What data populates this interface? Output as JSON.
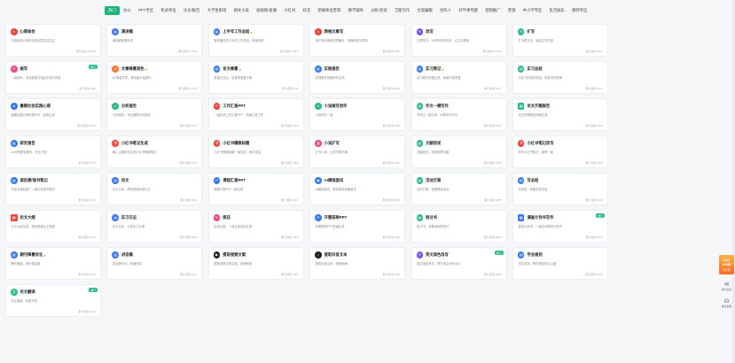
{
  "tabs": [
    {
      "label": "热门",
      "active": true
    },
    {
      "label": "办公"
    },
    {
      "label": "PPT专区"
    },
    {
      "label": "机关单位"
    },
    {
      "label": "论文/报告"
    },
    {
      "label": "大学生职场"
    },
    {
      "label": "网文小说"
    },
    {
      "label": "短视频/直播"
    },
    {
      "label": "小红书"
    },
    {
      "label": "抖音"
    },
    {
      "label": "新媒体运营等"
    },
    {
      "label": "教学辅导"
    },
    {
      "label": "分析/咨询"
    },
    {
      "label": "万能写作"
    },
    {
      "label": "文案编辑"
    },
    {
      "label": "创作人"
    },
    {
      "label": "开学季专题"
    },
    {
      "label": "营销推广"
    },
    {
      "label": "营销"
    },
    {
      "label": "中小学专区"
    },
    {
      "label": "生活娱乐"
    },
    {
      "label": "教师专区"
    }
  ],
  "colors": {
    "accent": "#1fb37a",
    "blue": "#3a7bf4",
    "red": "#f0453c",
    "orange": "#ff7a2a",
    "green": "#2ebc83",
    "purple": "#6a5cf6",
    "pink": "#f04a7e",
    "dark": "#222222"
  },
  "cards": [
    {
      "title": "心得体会",
      "desc": "文档精准心得体会的创意生成文文",
      "meta": "累计使用 257/23",
      "icon": "flame-icon",
      "color": "#f0453c",
      "sym": "♦"
    },
    {
      "title": "演讲稿",
      "desc": "演讲稿快速写作",
      "meta": "累计使用 7/51/5",
      "icon": "document-icon",
      "color": "#3a7bf4",
      "sym": "▤"
    },
    {
      "title": "上半年工作总结",
      "flame": true,
      "desc": "做到通过的个月的工作总结，快速完成",
      "meta": "累计使用 7/58/7",
      "icon": "document-icon",
      "color": "#3a7bf4",
      "sym": "▤"
    },
    {
      "title": "网络文章写",
      "desc": "用于现代网络文章编写，快速完成文章标",
      "meta": "累计使用 4/6/1",
      "icon": "flame-icon",
      "color": "#f0453c",
      "sym": "♦"
    },
    {
      "title": "改写",
      "desc": "文章改写，AI写作改写优化，让文字更美",
      "meta": "累计使用 4/7/48",
      "icon": "pen-icon",
      "color": "#6a5cf6",
      "sym": "✎"
    },
    {
      "title": "扩写",
      "desc": "扩写短文本，增加文字内容",
      "meta": "累计使用 4/1/2",
      "icon": "pen-icon",
      "color": "#2ebc83",
      "sym": "✎"
    },
    {
      "title": "",
      "desc": "",
      "meta": "",
      "icon": "",
      "color": "",
      "sym": "",
      "empty": true
    },
    {
      "title": "续写",
      "badge": "热门",
      "desc": "一键续写，完成各类文档后半部分内容",
      "meta": "累计使用 5/63",
      "icon": "pen-icon",
      "color": "#f04a7e",
      "sym": "✎"
    },
    {
      "title": "文章降重润色",
      "flame": true,
      "desc": "AI 降重文章，原创度大幅提升",
      "meta": "累计使用 7/47/6",
      "icon": "flame-icon",
      "color": "#ff7a2a",
      "sym": "♦"
    },
    {
      "title": "论文降重",
      "flame": true,
      "desc": "降重论文后，查重率显著下降",
      "meta": "累计使用 4/59",
      "icon": "document-icon",
      "color": "#3a7bf4",
      "sym": "▤"
    },
    {
      "title": "实践报告",
      "desc": "实践报告快速写作生成",
      "meta": "累计使用 4/6/1",
      "icon": "document-icon",
      "color": "#3a7bf4",
      "sym": "▤"
    },
    {
      "title": "实习周记",
      "flame": true,
      "desc": "实习周记快速生成，每周内容完整",
      "meta": "累计使用 4/6/1",
      "icon": "document-icon",
      "color": "#3a7bf4",
      "sym": "▤"
    },
    {
      "title": "实习总结",
      "desc": "为实习阶段写总结，提高写作效率",
      "meta": "累计使用 4/6/1",
      "icon": "document-icon",
      "color": "#2ebc83",
      "sym": "▤"
    },
    {
      "title": "",
      "desc": "",
      "meta": "",
      "icon": "",
      "color": "",
      "sym": "",
      "empty": true
    },
    {
      "title": "暑期社会实践心得",
      "desc": "暑期实践心得快速写作，精炼生成",
      "meta": "累计使用 4/6/61",
      "icon": "user-icon",
      "color": "#3a7bf4",
      "sym": "●"
    },
    {
      "title": "分析报告",
      "desc": "分析报告，专业数据分析报告",
      "meta": "累计使用 4/7/6",
      "icon": "chart-icon",
      "color": "#2ebc83",
      "sym": "◐"
    },
    {
      "title": "工作汇报PPT",
      "desc": "一键生成工作汇报PPT，快速汇报工作",
      "meta": "累计使用 4/8/1",
      "icon": "ppt-icon",
      "color": "#f0453c",
      "sym": "P"
    },
    {
      "title": "小说续写创作",
      "desc": "小说续写一键",
      "meta": "累计使用 4/6/5",
      "icon": "leaf-icon",
      "color": "#2ebc83",
      "sym": "❧"
    },
    {
      "title": "作文一键写作",
      "desc": "写作文一键生成，AI帮你写作文",
      "meta": "累计使用 4/6/8",
      "icon": "document-icon",
      "color": "#2ebc83",
      "sym": "▤"
    },
    {
      "title": "论文开题报告",
      "desc": "论文开题报告快速生成",
      "meta": "累计使用 4/6/4",
      "icon": "paper-icon",
      "color": "#2ebc83",
      "sym": "▦",
      "square": true
    },
    {
      "title": "",
      "desc": "",
      "meta": "",
      "icon": "",
      "color": "",
      "sym": "",
      "empty": true
    },
    {
      "title": "研究报告",
      "desc": "AI 研究报告撰写，专业分析",
      "meta": "累计使用 4/6/7",
      "icon": "document-icon",
      "color": "#3a7bf4",
      "sym": "▤"
    },
    {
      "title": "小红书笔记生成",
      "desc": "输入主题即可生成小红书爆款笔记",
      "meta": "累计使用 4/7/9",
      "icon": "xhs-icon",
      "color": "#f0453c",
      "sym": "书"
    },
    {
      "title": "小红书爆款标题",
      "desc": "小红书爆款标题一键生成，吸引流量",
      "meta": "累计使用 4/8/1",
      "icon": "xhs-icon",
      "color": "#f0453c",
      "sym": "书"
    },
    {
      "title": "小说扩写",
      "desc": "扩写小说，让情节更丰满",
      "meta": "累计使用 4/6/5",
      "icon": "book-icon",
      "color": "#f04a7e",
      "sym": "▮"
    },
    {
      "title": "文献综述",
      "desc": "文献综述，轻松梳理文献",
      "meta": "累计使用 4/6/8",
      "icon": "document-icon",
      "color": "#2ebc83",
      "sym": "▤"
    },
    {
      "title": "小红书笔记改写",
      "desc": "改写小红书笔记，焕然一新",
      "meta": "累计使用 4/6/4",
      "icon": "xhs-icon",
      "color": "#f0453c",
      "sym": "书"
    },
    {
      "title": "",
      "desc": "",
      "meta": "",
      "icon": "",
      "color": "",
      "sym": "",
      "empty": true
    },
    {
      "title": "读后感/读书笔记",
      "desc": "不会写读后感？一键生成读书笔记",
      "meta": "累计使用 4/6/1",
      "icon": "book-icon",
      "color": "#3a7bf4",
      "sym": "▤"
    },
    {
      "title": "论文",
      "desc": "论文生成，帮你快速完成论文",
      "meta": "累计使用 4/6/6",
      "icon": "document-icon",
      "color": "#3a7bf4",
      "sym": "▤"
    },
    {
      "title": "课程汇报PPT",
      "desc": "课程汇报PPT一键生成",
      "meta": "累计使用 4/8/1",
      "icon": "ppt-icon",
      "color": "#3a7bf4",
      "sym": "P"
    },
    {
      "title": "AI模拟面试",
      "desc": "AI模拟面试，帮你提前准备面试",
      "meta": "累计使用 4/6/5",
      "icon": "chat-icon",
      "color": "#3a7bf4",
      "sym": "◉"
    },
    {
      "title": "活动方案",
      "desc": "活动方案，快速策划活动",
      "meta": "累计使用 4/6/8",
      "icon": "document-icon",
      "color": "#2ebc83",
      "sym": "▤"
    },
    {
      "title": "写总结",
      "desc": "写总结，快速生成总结",
      "meta": "累计使用 4/6/4",
      "icon": "document-icon",
      "color": "#3a7bf4",
      "sym": "▤"
    },
    {
      "title": "",
      "desc": "",
      "meta": "",
      "icon": "",
      "color": "",
      "sym": "",
      "empty": true
    },
    {
      "title": "论文大纲",
      "desc": "论文大纲生成，轻松搭建论文框架",
      "meta": "累计使用 4/6/1",
      "icon": "paper-icon",
      "color": "#f0453c",
      "sym": "▦",
      "square": true
    },
    {
      "title": "实习日志",
      "desc": "实习日志，记录实习点滴",
      "meta": "累计使用 4/6/6",
      "icon": "document-icon",
      "color": "#3a7bf4",
      "sym": "▤"
    },
    {
      "title": "探店",
      "desc": "探店文案，一键生成探店文案",
      "meta": "累计使用 4/8/1",
      "icon": "pen-icon",
      "color": "#f04a7e",
      "sym": "✎"
    },
    {
      "title": "开题答辩PPT",
      "desc": "开题答辩PPT快速生成",
      "meta": "累计使用 4/6/5",
      "icon": "ppt-icon",
      "color": "#3a7bf4",
      "sym": "P"
    },
    {
      "title": "检讨书",
      "desc": "检讨书，诚恳深刻的检讨",
      "meta": "累计使用 4/6/8",
      "icon": "document-icon",
      "color": "#2ebc83",
      "sym": "▤"
    },
    {
      "title": "调查计划书写作",
      "badge": "热门",
      "desc": "调查计划书，一键生成调查计划书",
      "meta": "累计使用 4/6/4",
      "icon": "paper-icon",
      "color": "#3a7bf4",
      "sym": "▦",
      "square": true
    },
    {
      "title": "",
      "desc": "",
      "meta": "",
      "icon": "",
      "color": "",
      "sym": "",
      "empty": true
    },
    {
      "title": "期刊降重优化",
      "flame": true,
      "desc": "期刊降重，提升原创度",
      "meta": "累计使用 4/6/1",
      "icon": "document-icon",
      "color": "#3a7bf4",
      "sym": "▤"
    },
    {
      "title": "讲话稿",
      "desc": "讲话稿写作，快速完成",
      "meta": "累计使用 4/6/6",
      "icon": "document-icon",
      "color": "#3a7bf4",
      "sym": "▤"
    },
    {
      "title": "提取视频文案",
      "desc": "提取视频中的文案，快速转换",
      "meta": "累计使用 4/8/1",
      "icon": "video-icon",
      "color": "#222222",
      "sym": "▶"
    },
    {
      "title": "提取抖音文本",
      "desc": "提取抖音文本，快速转换",
      "meta": "累计使用 4/6/5",
      "icon": "tiktok-icon",
      "color": "#222222",
      "sym": "♪"
    },
    {
      "title": "英文润色改写",
      "badge": "热门",
      "desc": "英文润色改写，提升英文写作水平",
      "meta": "累计使用 4/6/8",
      "icon": "pen-icon",
      "color": "#6a5cf6",
      "sym": "✎"
    },
    {
      "title": "学业规划",
      "desc": "学业规划，帮你规划学业之路",
      "meta": "累计使用 4/6/4",
      "icon": "document-icon",
      "color": "#3a7bf4",
      "sym": "▤"
    },
    {
      "title": "",
      "desc": "",
      "meta": "",
      "icon": "",
      "color": "",
      "sym": "",
      "empty": true
    },
    {
      "title": "论文翻译",
      "badge": "热门",
      "desc": "论文翻译，精准专业",
      "meta": "累计使用 4/6/1",
      "icon": "translate-icon",
      "color": "#2ebc83",
      "sym": "文"
    }
  ],
  "side": {
    "gift_top": "领福利",
    "gift_main": "199元",
    "gift_bottom": "大礼包",
    "tool1": "用户反馈",
    "tool2": "联系客服"
  }
}
